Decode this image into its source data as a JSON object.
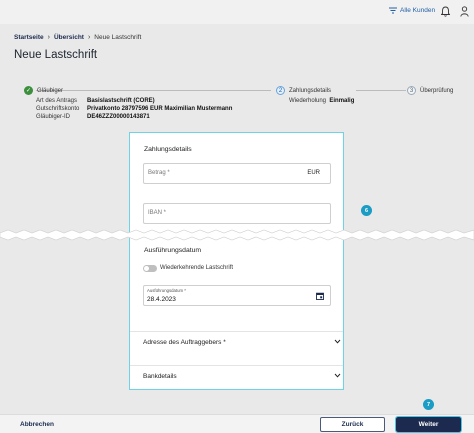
{
  "header": {
    "customers_link": "Alle Kunden"
  },
  "breadcrumb": {
    "home": "Startseite",
    "overview": "Übersicht",
    "current": "Neue Lastschrift"
  },
  "page_title": "Neue Lastschrift",
  "steps": [
    {
      "num": "✓",
      "label": "Gläubiger"
    },
    {
      "num": "2",
      "label": "Zahlungsdetails"
    },
    {
      "num": "3",
      "label": "Überprüfung"
    }
  ],
  "step1_details": [
    {
      "key": "Art des Antrags",
      "value": "Basislastschrift (CORE)"
    },
    {
      "key": "Gutschriftskonto",
      "value": "Privatkonto 28797596 EUR Maximilian Mustermann"
    },
    {
      "key": "Gläubiger-ID",
      "value": "DE46ZZZ00000143871"
    }
  ],
  "step2_details": {
    "key": "Wiederholung",
    "value": "Einmalig"
  },
  "form": {
    "payment_title": "Zahlungsdetails",
    "amount_placeholder": "Betrag *",
    "currency": "EUR",
    "iban_placeholder": "IBAN *",
    "execution_title": "Ausführungsdatum",
    "recurring_label": "Wiederkehrende Lastschrift",
    "date_label": "Ausführungsdatum *",
    "date_value": "28.4.2023",
    "payer_address": "Adresse des Auftraggebers *",
    "bank_details": "Bankdetails"
  },
  "badges": {
    "six": "6",
    "seven": "7"
  },
  "footer": {
    "cancel": "Abbrechen",
    "back": "Zurück",
    "next": "Weiter"
  }
}
